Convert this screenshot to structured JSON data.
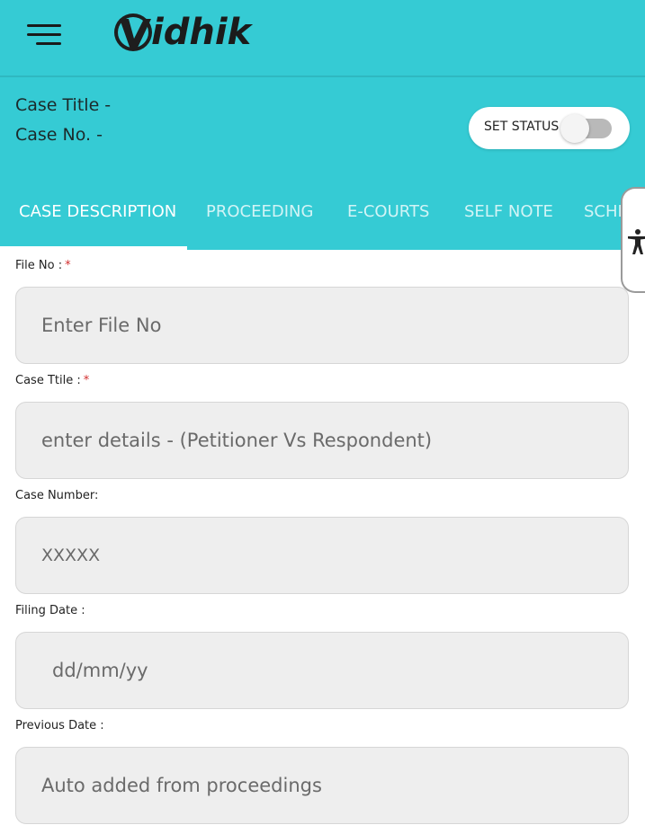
{
  "app": {
    "logo_initial": "V",
    "logo_text": "idhik",
    "brand_color": "#35CBD4"
  },
  "case_header": {
    "title_label": "Case Title -",
    "number_label": "Case No. -",
    "status_label": "SET STATUS",
    "status_on": false
  },
  "tabs": [
    {
      "label": "CASE DESCRIPTION",
      "active": true
    },
    {
      "label": "PROCEEDING",
      "active": false
    },
    {
      "label": "E-COURTS",
      "active": false
    },
    {
      "label": "SELF NOTE",
      "active": false
    },
    {
      "label": "SCHE",
      "active": false
    }
  ],
  "accessibility": {
    "icon": "accessibility-icon"
  },
  "form": {
    "fields": [
      {
        "label": "File No :",
        "required": true,
        "placeholder": "Enter File No",
        "value": ""
      },
      {
        "label": "Case Ttile :",
        "required": true,
        "placeholder": "enter details - (Petitioner Vs Respondent)",
        "value": ""
      },
      {
        "label": "Case Number:",
        "required": false,
        "placeholder": "XXXXX",
        "value": ""
      },
      {
        "label": "Filing Date :",
        "required": false,
        "placeholder": "dd/mm/yy",
        "value": ""
      },
      {
        "label": "Previous Date :",
        "required": false,
        "placeholder": "Auto added from proceedings",
        "value": ""
      }
    ],
    "required_mark": "*"
  }
}
